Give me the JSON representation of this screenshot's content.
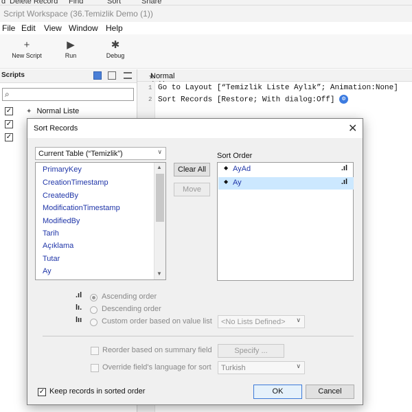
{
  "top_strip": {
    "items": [
      "d",
      "Delete Record",
      "Find",
      "Sort",
      "Share"
    ]
  },
  "window_title": "Script Workspace (36.Temizlik Demo (1))",
  "menu": [
    "File",
    "Edit",
    "View",
    "Window",
    "Help"
  ],
  "toolbar": {
    "new_script": "New Script",
    "run": "Run",
    "debug": "Debug"
  },
  "scripts_panel": {
    "title": "Scripts",
    "script_name": "Normal Liste"
  },
  "editor": {
    "tab_title": "Normal Aylık",
    "tab_marker": "★",
    "lines": [
      {
        "num": "1",
        "text": "Go to Layout [“Temizlik Liste Aylık”; Animation:None]"
      },
      {
        "num": "2",
        "text": "Sort Records [Restore; With dialog:Off]"
      }
    ]
  },
  "dialog": {
    "title": "Sort Records",
    "close_glyph": "✕",
    "table_select": "Current Table (“Temizlik”)",
    "fields": [
      "PrimaryKey",
      "CreationTimestamp",
      "CreatedBy",
      "ModificationTimestamp",
      "ModifiedBy",
      "Tarih",
      "Açıklama",
      "Tutar",
      "Ay"
    ],
    "clear_all": "Clear All",
    "move": "Move",
    "sort_order_label": "Sort Order",
    "sort_order": [
      {
        "field": "AyAd",
        "selected": false
      },
      {
        "field": "Ay",
        "selected": true
      }
    ],
    "ascending": "Ascending order",
    "descending": "Descending order",
    "custom": "Custom order based on value list",
    "value_list_select": "<No Lists Defined>",
    "reorder_label": "Reorder based on summary field",
    "specify": "Specify ...",
    "override_label": "Override field's language for sort",
    "language_select": "Turkish",
    "keep_sorted": "Keep records in sorted order",
    "ok": "OK",
    "cancel": "Cancel"
  }
}
